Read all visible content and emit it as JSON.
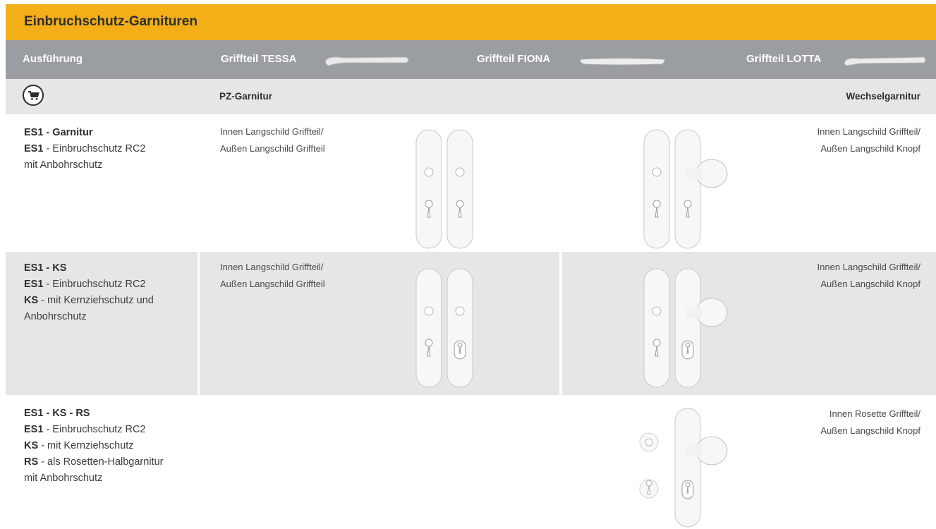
{
  "title": "Einbruchschutz-Garnituren",
  "header": {
    "col_ausfuehrung": "Ausführung",
    "col_tessa": "Griffteil TESSA",
    "col_fiona": "Griffteil FIONA",
    "col_lotta": "Griffteil LOTTA"
  },
  "subheader": {
    "cart_icon": "shopping-cart-icon",
    "pz": "PZ-Garnitur",
    "wechsel": "Wechselgarnitur"
  },
  "rows": [
    {
      "name": "ES1 - Garnitur",
      "lines": [
        {
          "code": "ES1",
          "text": " - Einbruchschutz RC2"
        },
        {
          "code": "",
          "text": "mit Anbohrschutz"
        }
      ],
      "left_label_1": "Innen Langschild Griffteil/",
      "left_label_2": "Außen Langschild Griffteil",
      "right_label_1": "Innen Langschild Griffteil/",
      "right_label_2": "Außen Langschild Knopf"
    },
    {
      "name": "ES1 - KS",
      "lines": [
        {
          "code": "ES1",
          "text": " - Einbruchschutz RC2"
        },
        {
          "code": "KS",
          "text": " - mit Kernziehschutz und"
        },
        {
          "code": "",
          "text": "Anbohrschutz"
        }
      ],
      "left_label_1": "Innen Langschild Griffteil/",
      "left_label_2": "Außen Langschild Griffteil",
      "right_label_1": "Innen Langschild Griffteil/",
      "right_label_2": "Außen Langschild Knopf"
    },
    {
      "name": "ES1 - KS - RS",
      "lines": [
        {
          "code": "ES1",
          "text": " - Einbruchschutz RC2"
        },
        {
          "code": "KS",
          "text": " - mit Kernziehschutz"
        },
        {
          "code": "RS",
          "text": " - als Rosetten-Halbgarnitur"
        },
        {
          "code": "",
          "text": "mit Anbohrschutz"
        }
      ],
      "right_label_1": "Innen Rosette Griffteil/",
      "right_label_2": "Außen Langschild Knopf"
    }
  ]
}
